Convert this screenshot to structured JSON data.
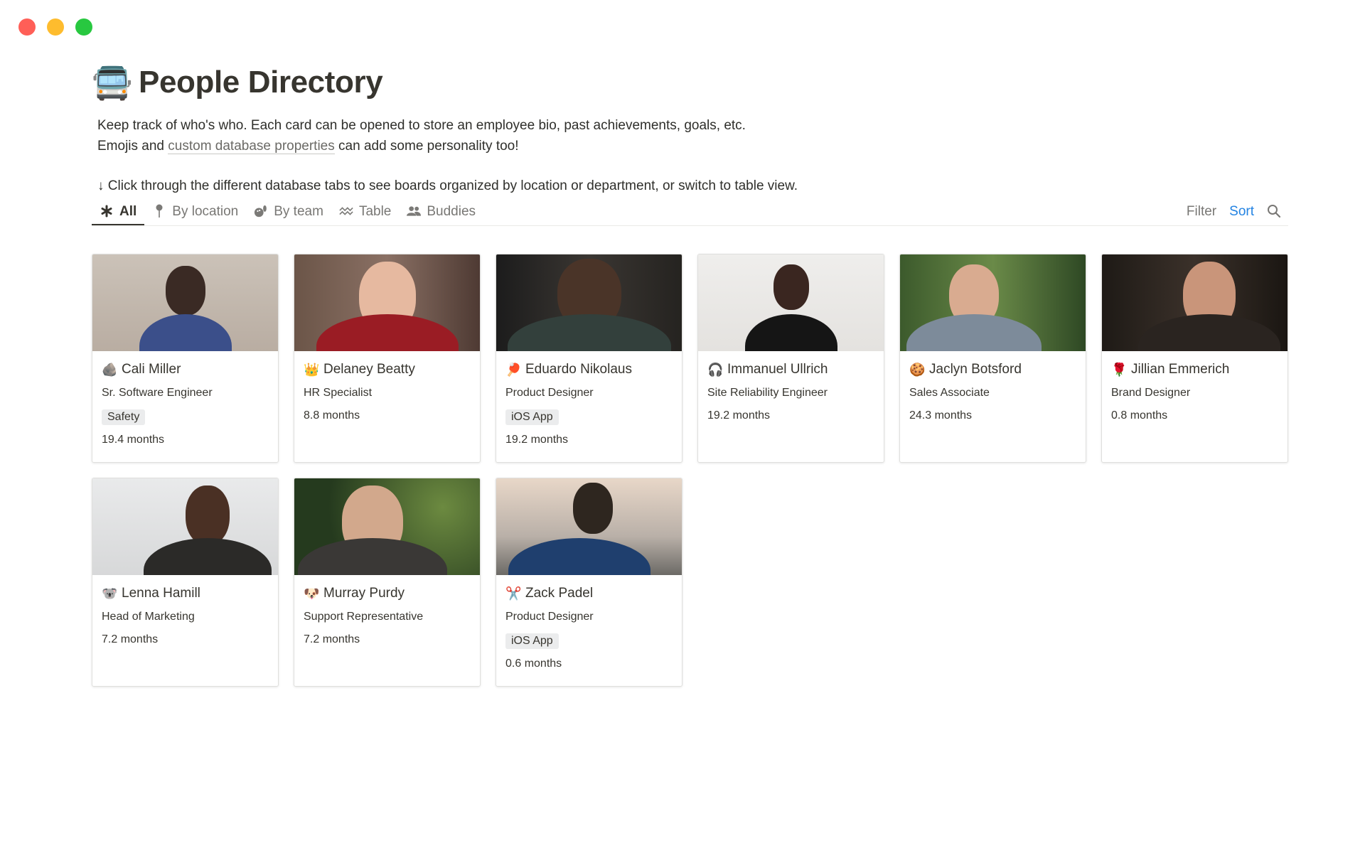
{
  "window": {
    "controls": [
      "close",
      "minimize",
      "maximize"
    ]
  },
  "page": {
    "icon": "🚍",
    "title": "People Directory",
    "desc_line1": "Keep track of who's who. Each card can be opened to store an employee bio, past achievements, goals, etc.",
    "desc_line2_before": "Emojis and ",
    "desc_line2_link": "custom database properties",
    "desc_line2_after": " can add some personality too!",
    "desc_line3": "↓ Click through the different database tabs to see boards organized by location or department, or switch to table view."
  },
  "tabs": [
    {
      "label": "All",
      "icon": "asterisk-icon"
    },
    {
      "label": "By location",
      "icon": "pin-icon"
    },
    {
      "label": "By team",
      "icon": "bowling-icon"
    },
    {
      "label": "Table",
      "icon": "wave-icon"
    },
    {
      "label": "Buddies",
      "icon": "people-icon"
    }
  ],
  "toolbar": {
    "filter": "Filter",
    "sort": "Sort"
  },
  "colors": {
    "accent": "#2383e2",
    "text": "#37352f",
    "muted": "#787774",
    "tag_bg": "#ebeced"
  },
  "cards": [
    {
      "emoji": "🪨",
      "name": "Cali Miller",
      "role": "Sr. Software Engineer",
      "tag": "Safety",
      "tenure": "19.4 months"
    },
    {
      "emoji": "👑",
      "name": "Delaney Beatty",
      "role": "HR Specialist",
      "tag": "",
      "tenure": "8.8 months"
    },
    {
      "emoji": "🏓",
      "name": "Eduardo Nikolaus",
      "role": "Product Designer",
      "tag": "iOS App",
      "tenure": "19.2 months"
    },
    {
      "emoji": "🎧",
      "name": "Immanuel Ullrich",
      "role": "Site Reliability Engineer",
      "tag": "",
      "tenure": "19.2 months"
    },
    {
      "emoji": "🍪",
      "name": "Jaclyn Botsford",
      "role": "Sales Associate",
      "tag": "",
      "tenure": "24.3 months"
    },
    {
      "emoji": "🌹",
      "name": "Jillian Emmerich",
      "role": "Brand Designer",
      "tag": "",
      "tenure": "0.8 months"
    },
    {
      "emoji": "🐨",
      "name": "Lenna Hamill",
      "role": "Head of Marketing",
      "tag": "",
      "tenure": "7.2 months"
    },
    {
      "emoji": "🐶",
      "name": "Murray Purdy",
      "role": "Support Representative",
      "tag": "",
      "tenure": "7.2 months"
    },
    {
      "emoji": "✂️",
      "name": "Zack Padel",
      "role": "Product Designer",
      "tag": "iOS App",
      "tenure": "0.6 months"
    }
  ]
}
